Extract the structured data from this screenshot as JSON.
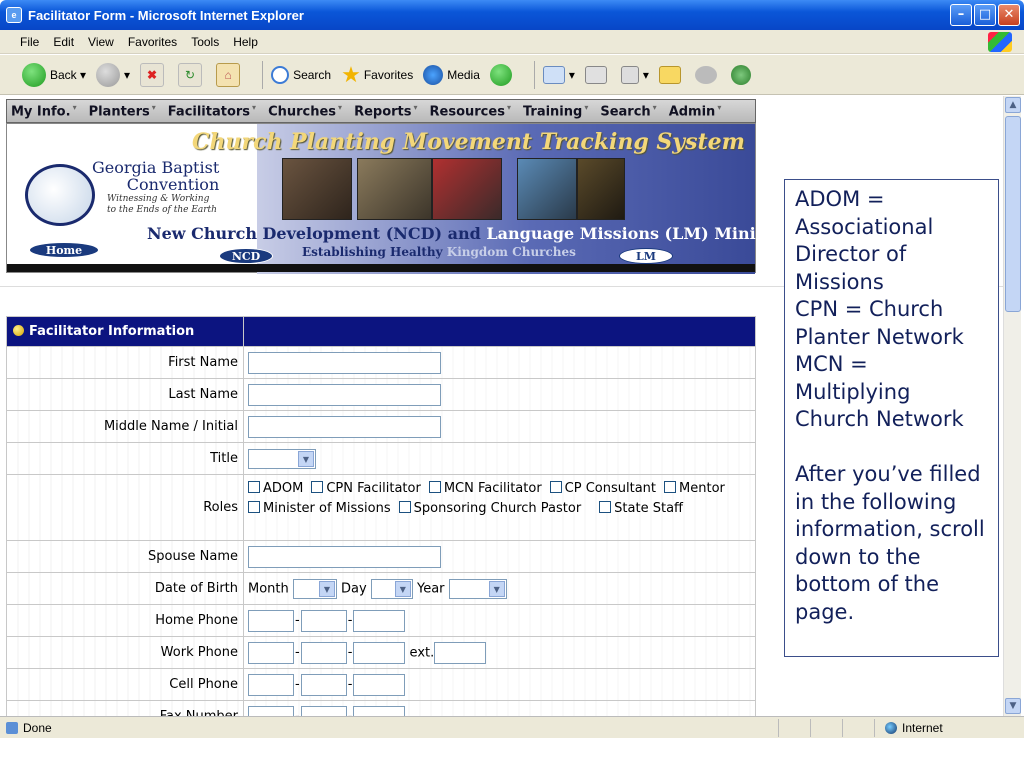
{
  "window": {
    "title": "Facilitator Form - Microsoft Internet Explorer"
  },
  "menubar": [
    "File",
    "Edit",
    "View",
    "Favorites",
    "Tools",
    "Help"
  ],
  "toolbar": {
    "back": "Back",
    "search": "Search",
    "favorites": "Favorites",
    "media": "Media"
  },
  "nav": [
    "My Info.",
    "Planters",
    "Facilitators",
    "Churches",
    "Reports",
    "Resources",
    "Training",
    "Search",
    "Admin"
  ],
  "banner": {
    "title": "Church Planting Movement Tracking System",
    "org_line1": "Georgia Baptist",
    "org_line2": "Convention",
    "org_tag1": "Witnessing & Working",
    "org_tag2": "to the Ends of the Earth",
    "ncd_text": "New Church Development (NCD) and",
    "lm_text": "Language Missions (LM) Ministries",
    "tagline_dark": "Establishing Healthy",
    "tagline_light": "Kingdom Churches",
    "home": "Home",
    "ncd": "NCD",
    "lm": "LM"
  },
  "form": {
    "header": "Facilitator Information",
    "first_name": "First Name",
    "last_name": "Last Name",
    "middle_name": "Middle Name / Initial",
    "title": "Title",
    "roles": "Roles",
    "role_options": [
      "ADOM",
      "CPN Facilitator",
      "MCN Facilitator",
      "CP Consultant",
      "Mentor",
      "Minister of Missions",
      "Sponsoring Church Pastor",
      "State Staff"
    ],
    "spouse": "Spouse Name",
    "dob": "Date of Birth",
    "dob_month": "Month",
    "dob_day": "Day",
    "dob_year": "Year",
    "home_phone": "Home Phone",
    "work_phone": "Work Phone",
    "ext": "ext.",
    "cell_phone": "Cell Phone",
    "fax": "Fax Number"
  },
  "note": "ADOM = Associational Director of Missions\nCPN = Church Planter Network\nMCN = Multiplying Church Network\n\nAfter you’ve filled in the following information, scroll down to the bottom of the page.",
  "status": {
    "left": "Done",
    "zone": "Internet"
  }
}
